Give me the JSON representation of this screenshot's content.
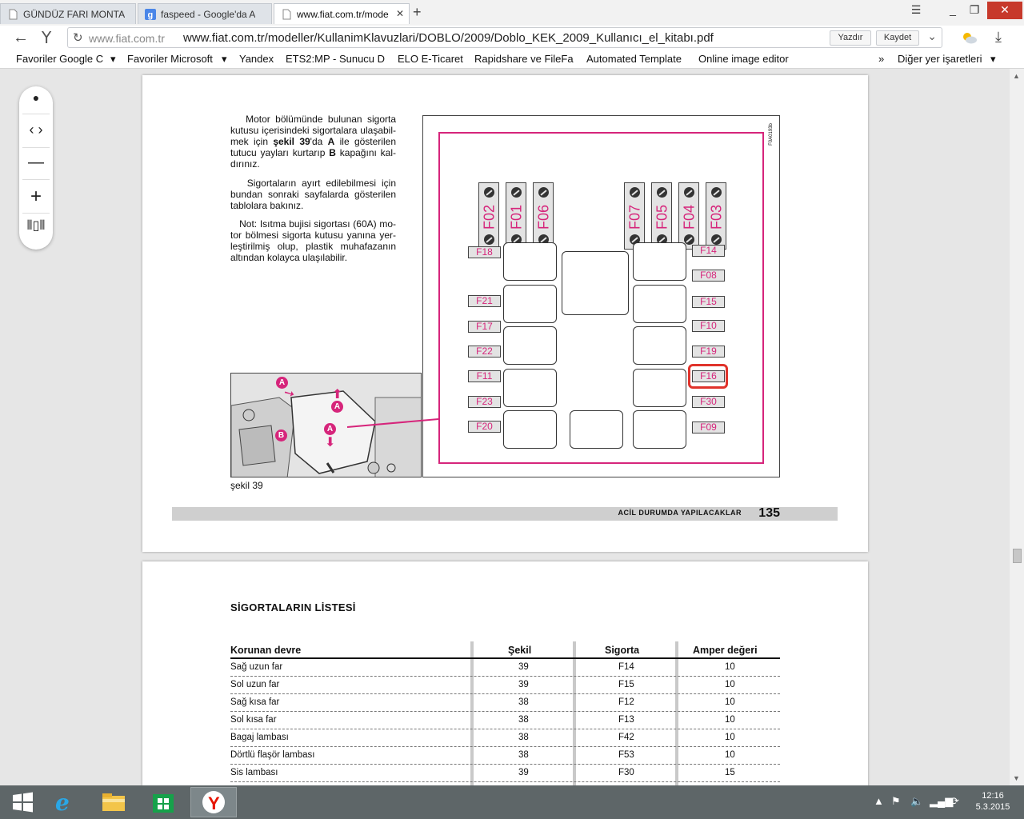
{
  "tabs": [
    {
      "title": "GÜNDÜZ FARI MONTA",
      "icon": "page-icon"
    },
    {
      "title": "faspeed - Google'da A",
      "icon": "google-icon"
    },
    {
      "title": "www.fiat.com.tr/mode",
      "icon": "page-icon"
    }
  ],
  "address": {
    "domain": "www.fiat.com.tr",
    "url": "www.fiat.com.tr/modeller/KullanimKlavuzlari/DOBLO/2009/Doblo_KEK_2009_Kullanıcı_el_kitabı.pdf",
    "print_label": "Yazdır",
    "save_label": "Kaydet"
  },
  "bookmarks": [
    "Favoriler Google C",
    "Favoriler Microsoft",
    "Yandex",
    "ETS2:MP - Sunucu D",
    "ELO E-Ticaret",
    "Rapidshare ve FileFa",
    "Automated Template",
    "Online image editor"
  ],
  "bookmarks_more": "»",
  "bookmarks_other": "Diğer yer işaretleri",
  "page1": {
    "para1_a": "Motor bölümünde bulunan sigorta kutusu içerisindeki sigortalara ulaşabil-mek için ",
    "para1_b": "şekil 39",
    "para1_c": "'da ",
    "para1_d": "A",
    "para1_e": " ile gösterilen tutucu yayları kurtarıp ",
    "para1_f": "B",
    "para1_g": " kapağını kal-dırınız.",
    "para2": "Sigortaların ayırt edilebilmesi için bundan sonraki sayfalarda gösterilen tablolara bakınız.",
    "para3": "Not: Isıtma bujisi sigortası (60A) mo-tor bölmesi sigorta kutusu yanına yer-leştirilmiş olup, plastik muhafazanın altından kolayca ulaşılabilir.",
    "diagram_code": "F0A0193b",
    "top_fuses": [
      "F02",
      "F01",
      "F06",
      "F07",
      "F05",
      "F04",
      "F03"
    ],
    "left_fuses": [
      "F18",
      "F21",
      "F17",
      "F22",
      "F11",
      "F23",
      "F20"
    ],
    "right_fuses": [
      "F14",
      "F08",
      "F15",
      "F10",
      "F19",
      "F16",
      "F30",
      "F09"
    ],
    "photo_labels": [
      "A",
      "A",
      "A",
      "B"
    ],
    "caption": "şekil 39",
    "chapter": "ACİL DURUMDA YAPILACAKLAR",
    "page_number": "135"
  },
  "page2": {
    "title": "SİGORTALARIN LİSTESİ",
    "columns": [
      "Korunan devre",
      "Şekil",
      "Sigorta",
      "Amper değeri"
    ],
    "rows": [
      [
        "Sağ uzun far",
        "39",
        "F14",
        "10"
      ],
      [
        "Sol uzun far",
        "39",
        "F15",
        "10"
      ],
      [
        "Sağ kısa far",
        "38",
        "F12",
        "10"
      ],
      [
        "Sol kısa far",
        "38",
        "F13",
        "10"
      ],
      [
        "Bagaj lambası",
        "38",
        "F42",
        "10"
      ],
      [
        "Dörtlü flaşör lambası",
        "38",
        "F53",
        "10"
      ],
      [
        "Sis lambası",
        "39",
        "F30",
        "15"
      ]
    ]
  },
  "clock": {
    "time": "12:16",
    "date": "5.3.2015"
  },
  "colors": {
    "fuse_magenta": "#d6257b",
    "highlight_red": "#e0332b",
    "close_red": "#c7392b"
  }
}
